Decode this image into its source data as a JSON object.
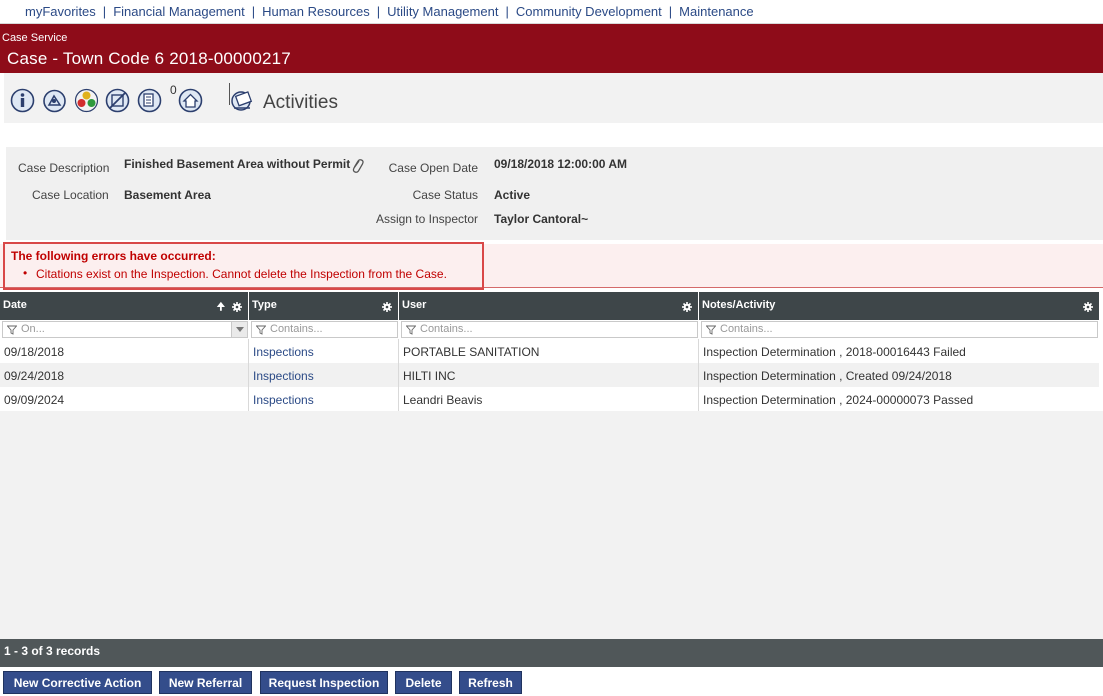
{
  "topnav": {
    "items": [
      "myFavorites",
      "Financial Management",
      "Human Resources",
      "Utility Management",
      "Community Development",
      "Maintenance"
    ],
    "separator": "|"
  },
  "header": {
    "subtitle": "Case Service",
    "title": "Case - Town Code 6 2018-00000217"
  },
  "toolbar": {
    "icons": [
      "info-icon",
      "plan-icon",
      "color-wheel-icon",
      "no-entry-icon",
      "documents-icon",
      "home-icon"
    ],
    "documents_count": "0",
    "section_icon": "activities-icon",
    "section_title": "Activities"
  },
  "details": {
    "case_description_label": "Case Description",
    "case_description": "Finished Basement Area without Permit",
    "case_location_label": "Case Location",
    "case_location": "Basement Area",
    "case_open_date_label": "Case Open Date",
    "case_open_date": "09/18/2018 12:00:00 AM",
    "case_status_label": "Case Status",
    "case_status": "Active",
    "assign_inspector_label": "Assign to Inspector",
    "assign_inspector": "Taylor Cantoral~"
  },
  "error": {
    "heading": "The following errors have occurred:",
    "items": [
      "Citations exist on the Inspection. Cannot delete the Inspection from the Case."
    ]
  },
  "grid": {
    "columns": [
      {
        "label": "Date",
        "filter_placeholder": "On...",
        "sort": "ascending"
      },
      {
        "label": "Type",
        "filter_placeholder": "Contains..."
      },
      {
        "label": "User",
        "filter_placeholder": "Contains..."
      },
      {
        "label": "Notes/Activity",
        "filter_placeholder": "Contains..."
      }
    ],
    "rows": [
      {
        "date": "09/18/2018",
        "type": "Inspections",
        "user": "PORTABLE SANITATION",
        "notes": "Inspection Determination , 2018-00016443 Failed"
      },
      {
        "date": "09/24/2018",
        "type": "Inspections",
        "user": "HILTI INC",
        "notes": "Inspection Determination , Created 09/24/2018"
      },
      {
        "date": "09/09/2024",
        "type": "Inspections",
        "user": "Leandri Beavis",
        "notes": "Inspection Determination , 2024-00000073 Passed"
      }
    ],
    "record_count": "1 - 3 of 3 records"
  },
  "actions": {
    "new_corrective_action": "New Corrective Action",
    "new_referral": "New Referral",
    "request_inspection": "Request Inspection",
    "delete": "Delete",
    "refresh": "Refresh"
  },
  "colors": {
    "title_band": "#8e0c19",
    "link": "#2b4a86",
    "error_text": "#c00000",
    "grid_header": "#3e4649",
    "button": "#344d8b"
  }
}
